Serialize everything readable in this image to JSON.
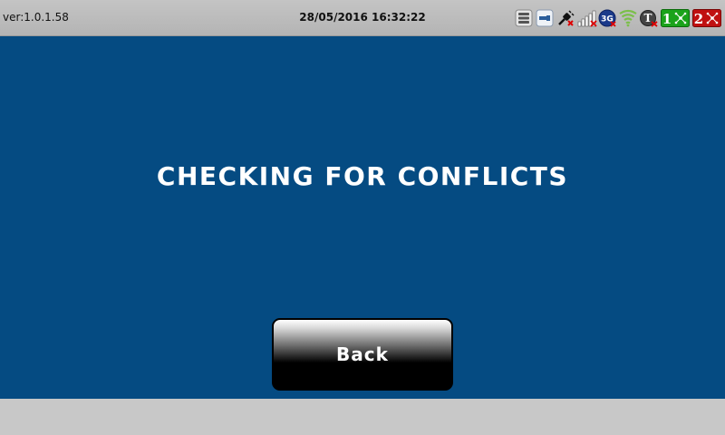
{
  "statusbar": {
    "version": "ver:1.0.1.58",
    "datetime": "28/05/2016 16:32:22",
    "icons": [
      "storage-icon",
      "usb-icon",
      "power-disconnected-icon",
      "signal-bars-icon",
      "3g-icon",
      "wifi-icon",
      "t-disabled-icon",
      "port-1-icon",
      "port-2-icon"
    ],
    "icon_3g_label": "3G",
    "icon_port1_label": "1",
    "icon_port2_label": "2"
  },
  "main": {
    "message": "CHECKING FOR CONFLICTS",
    "back_label": "Back"
  },
  "colors": {
    "background": "#054b82",
    "statusbar": "#bdbdbd",
    "button": "#000000",
    "port1": "#1aa31a",
    "port2": "#c01010"
  }
}
